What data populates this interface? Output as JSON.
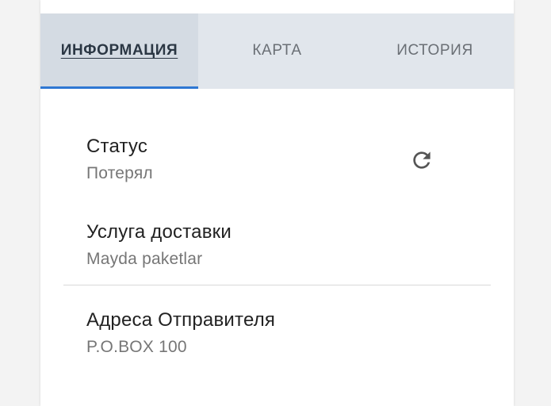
{
  "tabs": [
    {
      "label": "ИНФОРМАЦИЯ",
      "active": true
    },
    {
      "label": "КАРТА",
      "active": false
    },
    {
      "label": "ИСТОРИЯ",
      "active": false
    }
  ],
  "info": {
    "status_label": "Статус",
    "status_value": "Потерял",
    "service_label": "Услуга доставки",
    "service_value": "Mayda paketlar",
    "sender_address_label": "Адреса Отправителя",
    "sender_address_value": "P.O.BOX 100"
  },
  "icons": {
    "refresh": "refresh-icon"
  },
  "colors": {
    "tab_bar": "#e1e6ec",
    "active_tab": "#d4dbe3",
    "active_indicator": "#2f78d3"
  }
}
